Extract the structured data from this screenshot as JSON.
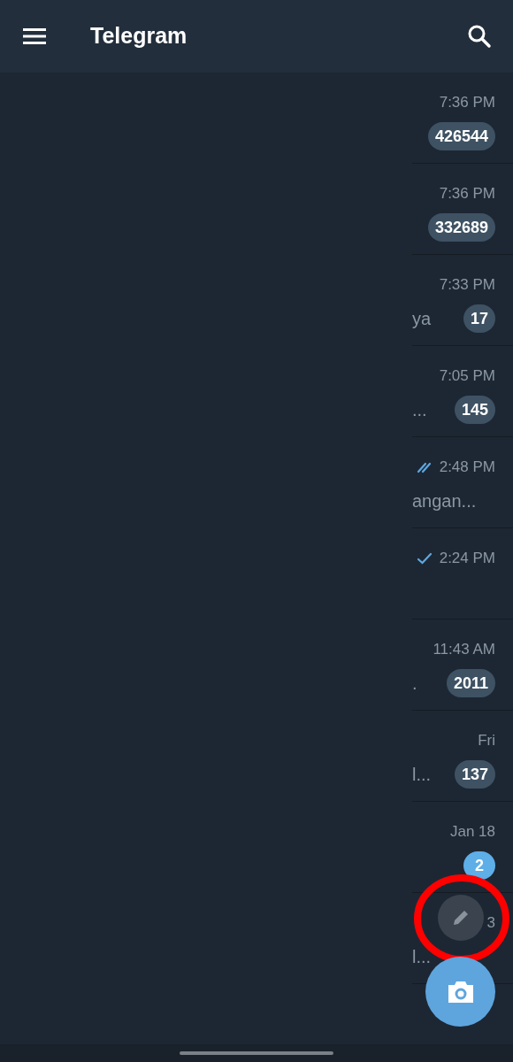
{
  "header": {
    "title": "Telegram"
  },
  "chats": [
    {
      "time": "7:36 PM",
      "badge": "426544",
      "muted": true
    },
    {
      "time": "7:36 PM",
      "badge": "332689",
      "muted": true
    },
    {
      "time": "7:33 PM",
      "preview": "ya",
      "badge": "17",
      "muted": true
    },
    {
      "time": "7:05 PM",
      "preview": "...",
      "badge": "145",
      "muted": true
    },
    {
      "time": "2:48 PM",
      "kind": "read",
      "preview": "angan..."
    },
    {
      "time": "2:24 PM",
      "kind": "sent"
    },
    {
      "time": "11:43 AM",
      "preview": ".",
      "badge": "2011",
      "muted": true
    },
    {
      "time": "Fri",
      "preview": "l...",
      "badge": "137",
      "muted": true
    },
    {
      "time": "Jan 18",
      "badge": "2",
      "muted": false
    },
    {
      "time": "3",
      "preview": "l..."
    }
  ]
}
